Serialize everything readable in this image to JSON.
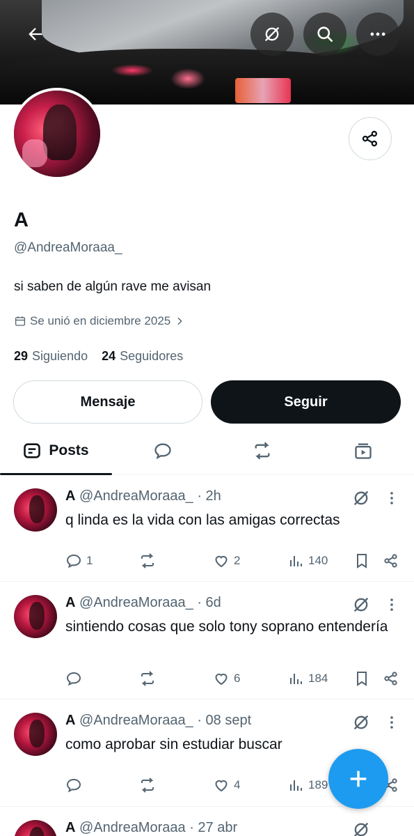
{
  "profile": {
    "display_name": "A",
    "handle": "@AndreaMoraaa_",
    "bio": "si saben de algún rave me avisan",
    "joined": "Se unió en diciembre 2025",
    "following_count": "29",
    "following_label": "Siguiendo",
    "followers_count": "24",
    "followers_label": "Seguidores"
  },
  "buttons": {
    "message": "Mensaje",
    "follow": "Seguir"
  },
  "tabs": {
    "posts": "Posts"
  },
  "posts": [
    {
      "name": "A",
      "handle": "@AndreaMoraaa_",
      "time": "· 2h",
      "text": "q linda es la vida con las amigas correctas",
      "replies": "1",
      "reposts": "",
      "likes": "2",
      "views": "140"
    },
    {
      "name": "A",
      "handle": "@AndreaMoraaa_",
      "time": "· 6d",
      "text": "sintiendo cosas que solo tony soprano entendería",
      "replies": "",
      "reposts": "",
      "likes": "6",
      "views": "184"
    },
    {
      "name": "A",
      "handle": "@AndreaMoraaa_",
      "time": "· 08 sept",
      "text": "como aprobar sin estudiar buscar",
      "replies": "",
      "reposts": "",
      "likes": "4",
      "views": "189"
    },
    {
      "name": "A",
      "handle": "@AndreaMoraaa",
      "time": "· 27 abr",
      "text": ""
    }
  ],
  "icons": {
    "back": "arrow-left-icon",
    "grok": "grok-icon",
    "search": "search-icon",
    "more": "more-horizontal-icon",
    "share": "share-icon",
    "calendar": "calendar-icon",
    "compose": "plus-icon"
  },
  "colors": {
    "accent": "#1d9bf0",
    "text": "#0f1419",
    "secondary": "#536471",
    "follow_bg": "#0f1419"
  }
}
